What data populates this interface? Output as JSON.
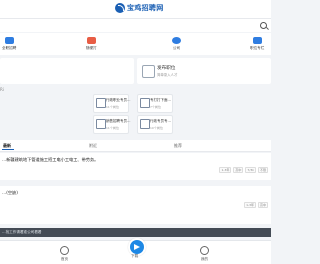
{
  "header": {
    "logo_text": "宝鸡招聘网"
  },
  "search": {
    "placeholder": ""
  },
  "quick_links": [
    {
      "label": "全职招聘",
      "color": "#2f7de1"
    },
    {
      "label": "随便打",
      "color": "#e85d45"
    },
    {
      "label": "公司",
      "color": "#2f7de1"
    },
    {
      "label": "职位专栏",
      "color": "#2f7de1"
    }
  ],
  "post_job": {
    "title": "发布职位",
    "subtitle": "简单录入人才"
  },
  "list_label": "Ri",
  "categories": [
    {
      "title": "行政职业专员…",
      "count": "11个岗位"
    },
    {
      "title": "专打打下面…",
      "count": "7个岗位"
    },
    {
      "title": "销售招聘专员…",
      "count": "11个岗位"
    },
    {
      "title": "行政专员专…",
      "count": "10个岗位"
    }
  ],
  "tabs": [
    {
      "label": "最新"
    },
    {
      "label": "附近"
    },
    {
      "label": "推荐"
    }
  ],
  "jobs": [
    {
      "title": "…新疆建筑地下管道施工招工电小工电工、带劳务。",
      "tags": [
        "1-3年",
        "高中",
        "7/3k",
        "不限"
      ]
    },
    {
      "title": "…(空缺)",
      "tags": [
        "1-3年",
        "高中"
      ]
    }
  ],
  "notice": {
    "text": "…找工作请看准公司看看"
  },
  "bottom_nav": [
    {
      "label": "首页"
    },
    {
      "label": "下载"
    },
    {
      "label": "我的"
    }
  ]
}
